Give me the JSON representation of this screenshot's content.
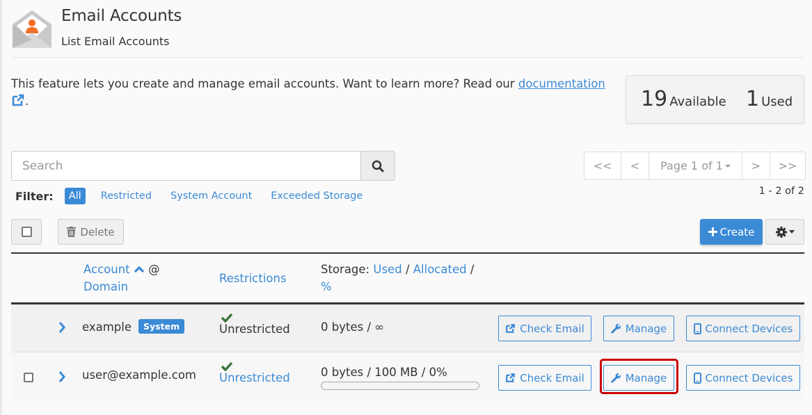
{
  "header": {
    "title": "Email Accounts",
    "subtitle": "List Email Accounts",
    "icon": "envelope-person-icon"
  },
  "description": {
    "text": "This feature lets you create and manage email accounts. Want to learn more? Read our ",
    "link_label": "documentation",
    "suffix": "."
  },
  "stats": {
    "available_count": "19",
    "available_label": "Available",
    "used_count": "1",
    "used_label": "Used"
  },
  "search": {
    "placeholder": "Search",
    "value": ""
  },
  "filter": {
    "label": "Filter:",
    "items": [
      {
        "label": "All",
        "active": true
      },
      {
        "label": "Restricted",
        "active": false
      },
      {
        "label": "System Account",
        "active": false
      },
      {
        "label": "Exceeded Storage",
        "active": false
      }
    ]
  },
  "pagination": {
    "first": "<<",
    "prev": "<",
    "page_label": "Page 1 of 1",
    "next": ">",
    "last": ">>",
    "range": "1 - 2 of 2"
  },
  "toolbar": {
    "delete_label": "Delete",
    "create_label": "Create"
  },
  "table": {
    "headers": {
      "account": "Account",
      "at": "@",
      "domain": "Domain",
      "restrictions": "Restrictions",
      "storage_prefix": "Storage:",
      "storage_used": "Used",
      "sep1": "/",
      "storage_allocated": "Allocated",
      "sep2": "/",
      "storage_percent": "%"
    },
    "rows": [
      {
        "account": "example",
        "badge": "System",
        "restriction": "Unrestricted",
        "storage": "0 bytes / ∞",
        "usage_percent": null,
        "actions": [
          "Check Email",
          "Manage",
          "Connect Devices"
        ]
      },
      {
        "account": "user@example.com",
        "badge": null,
        "restriction": "Unrestricted",
        "storage": "0 bytes / 100 MB / 0%",
        "usage_percent": 0,
        "actions": [
          "Check Email",
          "Manage",
          "Connect Devices"
        ]
      }
    ]
  },
  "colors": {
    "accent": "#3b8ad6",
    "check": "#3c763d",
    "highlight": "#cc0000",
    "logo_orange": "#f26c22"
  }
}
